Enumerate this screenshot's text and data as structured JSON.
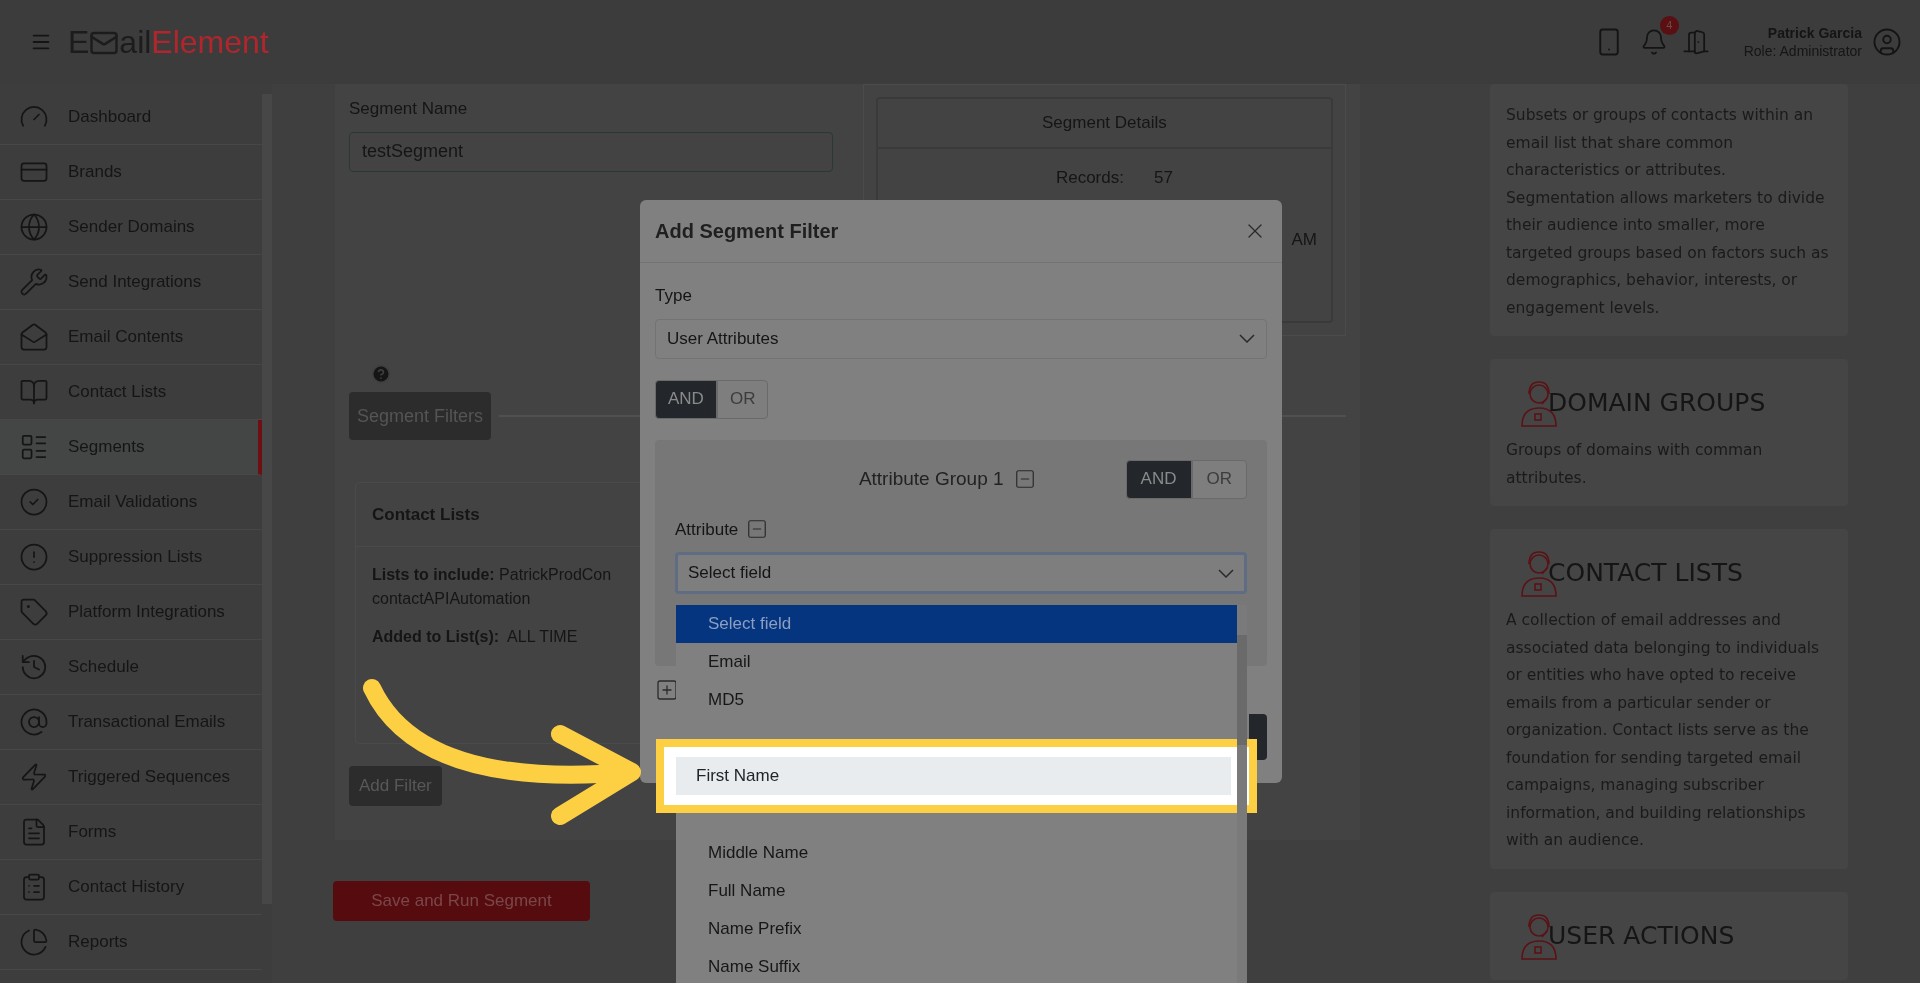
{
  "header": {
    "logo": {
      "lead": "E",
      "middle": "ail",
      "tail": "Element"
    },
    "notification_count": "4",
    "user": {
      "name": "Patrick Garcia",
      "role": "Role: Administrator"
    }
  },
  "sidebar": {
    "items": [
      {
        "label": "Dashboard",
        "selected": false
      },
      {
        "label": "Brands",
        "selected": false
      },
      {
        "label": "Sender Domains",
        "selected": false
      },
      {
        "label": "Send Integrations",
        "selected": false
      },
      {
        "label": "Email Contents",
        "selected": false
      },
      {
        "label": "Contact Lists",
        "selected": false
      },
      {
        "label": "Segments",
        "selected": true
      },
      {
        "label": "Email Validations",
        "selected": false
      },
      {
        "label": "Suppression Lists",
        "selected": false
      },
      {
        "label": "Platform Integrations",
        "selected": false
      },
      {
        "label": "Schedule",
        "selected": false
      },
      {
        "label": "Transactional Emails",
        "selected": false
      },
      {
        "label": "Triggered Sequences",
        "selected": false
      },
      {
        "label": "Forms",
        "selected": false
      },
      {
        "label": "Contact History",
        "selected": false
      },
      {
        "label": "Reports",
        "selected": false
      }
    ]
  },
  "segment_form": {
    "name_label": "Segment Name",
    "name_value": "testSegment",
    "filters_button": "Segment Filters",
    "contact_lists": {
      "title": "Contact Lists",
      "include": "**Lists to include:** PatrickProdCon",
      "include_more": "contactAPIAutomation",
      "added_label": "Added to List(s):",
      "added_value": "ALL TIME"
    },
    "add_filter_button": "Add Filter",
    "save_button": "Save and Run Segment"
  },
  "segment_details": {
    "title": "Segment Details",
    "records_label": "Records:",
    "records_value": "57",
    "date_fragment": "AM"
  },
  "modal": {
    "title": "Add Segment Filter",
    "type_label": "Type",
    "type_value": "User Attributes",
    "logic": [
      {
        "label": "AND",
        "selected": true
      },
      {
        "label": "OR",
        "selected": false
      }
    ],
    "group": {
      "title": "Attribute Group 1",
      "logic": [
        {
          "label": "AND",
          "selected": true
        },
        {
          "label": "OR",
          "selected": false
        }
      ],
      "attribute_label": "Attribute",
      "field_value": "Select field",
      "options": [
        {
          "label": "Select field",
          "selected": true,
          "spotlight": false
        },
        {
          "label": "Email",
          "selected": false,
          "spotlight": false
        },
        {
          "label": "MD5",
          "selected": false,
          "spotlight": false
        },
        {
          "label": "First Name",
          "selected": false,
          "spotlight": true
        },
        {
          "label": "Middle Name",
          "selected": false,
          "spotlight": false
        },
        {
          "label": "Full Name",
          "selected": false,
          "spotlight": false
        },
        {
          "label": "Name Prefix",
          "selected": false,
          "spotlight": false
        },
        {
          "label": "Name Suffix",
          "selected": false,
          "spotlight": false
        }
      ]
    }
  },
  "info_cards": [
    {
      "text": "Subsets or groups of contacts within an email list that share common characteristics or attributes. Segmentation allows marketers to divide their audience into smaller, more targeted groups based on factors such as demographics, behavior, interests, or engagement levels."
    },
    {
      "title": "DOMAIN GROUPS",
      "text": "Groups of domains with comman attributes."
    },
    {
      "title": "CONTACT LISTS",
      "text": "A collection of email addresses and associated data belonging to individuals or entities who have opted to receive emails from a particular sender or organization. Contact lists serve as the foundation for sending targeted email campaigns, managing subscriber information, and building relationships with an audience."
    },
    {
      "title": "USER ACTIONS"
    }
  ]
}
